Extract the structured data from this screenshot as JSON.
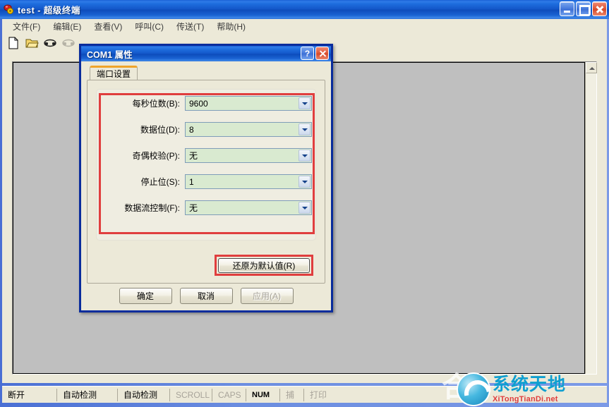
{
  "window": {
    "title": "test - 超级终端",
    "icon": "hyperterminal-phone-icon",
    "controls": {
      "minimize": "minimize-icon",
      "maximize": "maximize-icon",
      "close": "close-icon"
    }
  },
  "menubar": {
    "items": [
      {
        "label": "文件(F)"
      },
      {
        "label": "编辑(E)"
      },
      {
        "label": "查看(V)"
      },
      {
        "label": "呼叫(C)"
      },
      {
        "label": "传送(T)"
      },
      {
        "label": "帮助(H)"
      }
    ]
  },
  "toolbar": {
    "items": [
      {
        "name": "new-document-icon"
      },
      {
        "name": "open-folder-icon"
      },
      {
        "name": "call-phone-icon"
      },
      {
        "name": "disconnect-phone-icon"
      }
    ]
  },
  "dialog": {
    "title": "COM1 属性",
    "help_label": "?",
    "tab": {
      "label": "端口设置"
    },
    "fields": [
      {
        "label": "每秒位数(B):",
        "value": "9600"
      },
      {
        "label": "数据位(D):",
        "value": "8"
      },
      {
        "label": "奇偶校验(P):",
        "value": "无"
      },
      {
        "label": "停止位(S):",
        "value": "1"
      },
      {
        "label": "数据流控制(F):",
        "value": "无"
      }
    ],
    "restore_defaults_label": "还原为默认值(R)",
    "ok_label": "确定",
    "cancel_label": "取消",
    "apply_label": "应用(A)",
    "highlight_color": "#e03e3e"
  },
  "statusbar": {
    "cells": [
      {
        "label": "断开",
        "state": "active"
      },
      {
        "label": "自动检测",
        "state": "active"
      },
      {
        "label": "自动检测",
        "state": "active"
      },
      {
        "label": "SCROLL",
        "state": "dim"
      },
      {
        "label": "CAPS",
        "state": "dim"
      },
      {
        "label": "NUM",
        "state": "active"
      },
      {
        "label": "捕",
        "state": "dim"
      },
      {
        "label": "打印",
        "state": "dim"
      }
    ]
  },
  "watermark": {
    "mark": "合",
    "cn": "系统天地",
    "en": "XiTongTianDi.net"
  }
}
